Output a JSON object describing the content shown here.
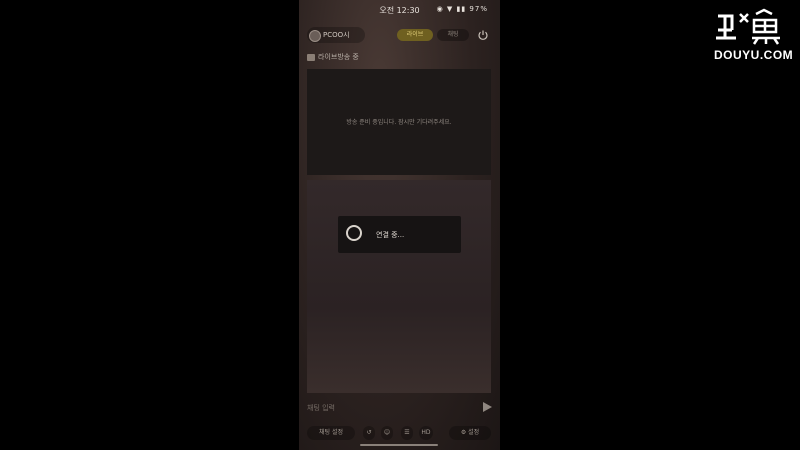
{
  "status_bar": {
    "time": "오전 12:30",
    "icons_text": "◉ ▼ ▮▮ 97%"
  },
  "header": {
    "profile_name": "PCOO시",
    "tab_active": "라이브",
    "tab_inactive": "채팅"
  },
  "room": {
    "label": "라이브방송 중"
  },
  "video": {
    "message": "방송 준비 중입니다. 잠시만 기다려주세요."
  },
  "loading": {
    "text": "연결 중..."
  },
  "chat_input": {
    "placeholder": "채팅 입력"
  },
  "toolbar": {
    "button_1": "채팅 설정",
    "button_2": "↺",
    "button_3": "☺",
    "button_4": "☰",
    "button_5": "HD",
    "button_6": "⚙ 설정"
  },
  "watermark": {
    "brand": "DOUYU.COM"
  },
  "colors": {
    "accent_tab": "#6f6020",
    "accent_tab_text": "#e2cf7a",
    "background": "#000000"
  },
  "icons": [
    "power-icon",
    "spinner-icon",
    "send-icon",
    "douyu-logo-icon"
  ]
}
